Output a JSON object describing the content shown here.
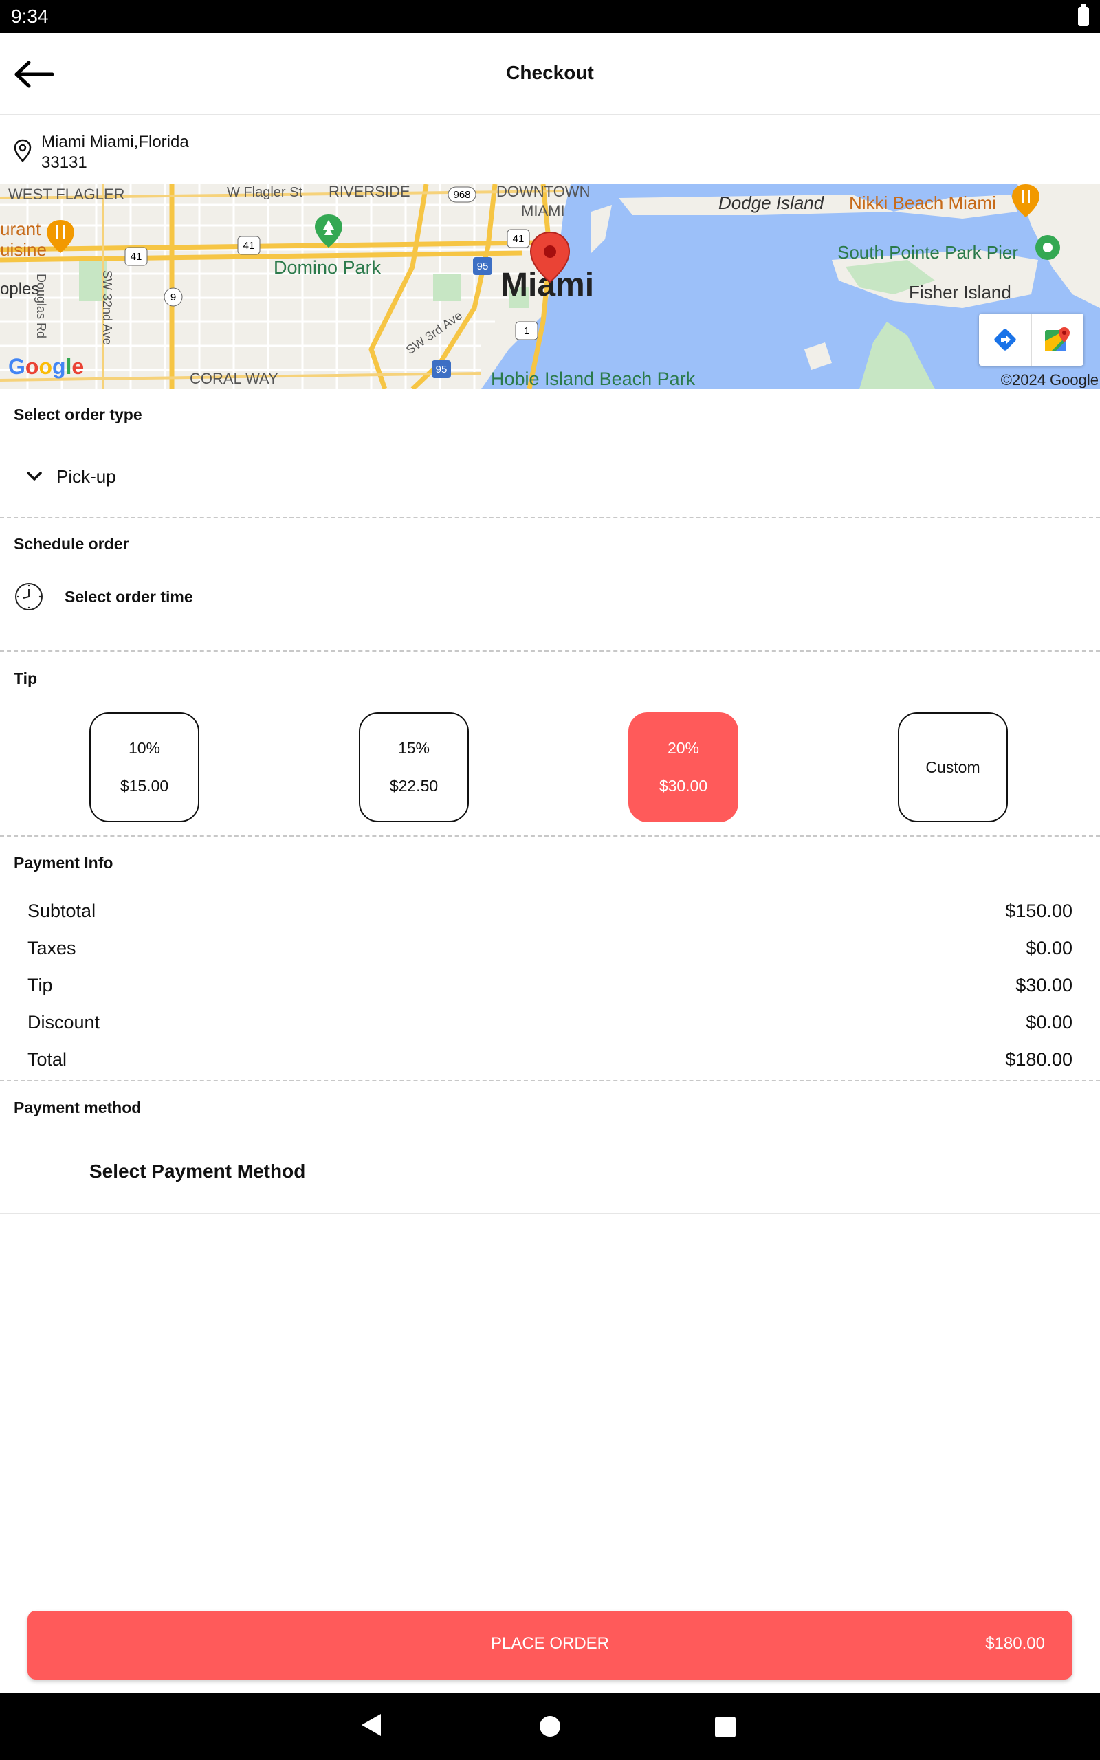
{
  "status_bar": {
    "time": "9:34"
  },
  "header": {
    "title": "Checkout",
    "back_icon": "arrow-left-icon"
  },
  "address": {
    "line1": "Miami  Miami,Florida",
    "line2": "33131",
    "icon": "map-pin-icon"
  },
  "map": {
    "labels": {
      "west_flagler": "WEST FLAGLER",
      "w_flagler_st": "W Flagler St",
      "riverside": "RIVERSIDE",
      "downtown": "DOWNTOWN",
      "miami_district": "MIAMI",
      "dodge_island": "Dodge Island",
      "nikki_beach": "Nikki Beach Miami",
      "south_pointe": "South Pointe Park Pier",
      "fisher_island": "Fisher Island",
      "miami": "Miami",
      "domino_park": "Domino Park",
      "restaurant_a": "urant",
      "restaurant_b": "uisine",
      "oples": "oples",
      "douglas_rd": "Douglas Rd",
      "sw_32nd": "SW 32nd Ave",
      "sw_3rd": "SW 3rd Ave",
      "coral_way": "CORAL WAY",
      "hobie_island": "Hobie Island Beach Park",
      "shield_968": "968",
      "shield_41": "41",
      "shield_95": "95",
      "shield_9": "9",
      "shield_1": "1"
    },
    "google_logo": "Google",
    "copyright": "©2024 Google",
    "directions_icon": "directions-icon",
    "maps_app_icon": "google-maps-icon"
  },
  "order_type": {
    "section_title": "Select order type",
    "value": "Pick-up",
    "icon": "chevron-down-icon"
  },
  "schedule": {
    "section_title": "Schedule order",
    "label": "Select order time",
    "icon": "clock-icon"
  },
  "tip": {
    "section_title": "Tip",
    "options": [
      {
        "percent": "10%",
        "amount": "$15.00",
        "selected": false
      },
      {
        "percent": "15%",
        "amount": "$22.50",
        "selected": false
      },
      {
        "percent": "20%",
        "amount": "$30.00",
        "selected": true
      },
      {
        "label": "Custom",
        "selected": false
      }
    ],
    "selected_color": "#ff5a5a"
  },
  "payment_info": {
    "section_title": "Payment Info",
    "rows": [
      {
        "label": "Subtotal",
        "value": "$150.00"
      },
      {
        "label": "Taxes",
        "value": "$0.00"
      },
      {
        "label": "Tip",
        "value": "$30.00"
      },
      {
        "label": "Discount",
        "value": "$0.00"
      },
      {
        "label": "Total",
        "value": "$180.00"
      }
    ]
  },
  "payment_method": {
    "section_title": "Payment method",
    "label": "Select Payment Method"
  },
  "place_order": {
    "label": "PLACE ORDER",
    "total": "$180.00",
    "color": "#ff5a5a"
  },
  "nav_bar": {
    "back_icon": "triangle-back-icon",
    "home_icon": "circle-home-icon",
    "recents_icon": "square-recents-icon"
  }
}
